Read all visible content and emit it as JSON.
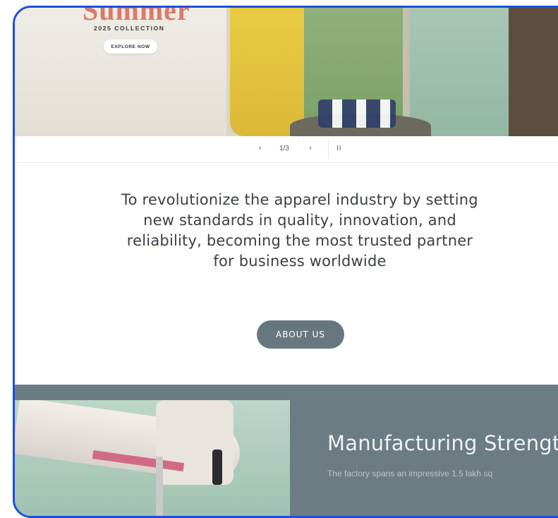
{
  "hero": {
    "title": "Summer",
    "subtitle": "2025 COLLECTION",
    "cta_label": "EXPLORE NOW"
  },
  "slider": {
    "prev_glyph": "‹",
    "counter": "1/3",
    "next_glyph": "›",
    "pause_glyph": "II"
  },
  "mission": {
    "text": "To revolutionize the apparel industry by setting new standards in quality, innovation, and reliability, becoming the most trusted partner for business worldwide",
    "button_label": "ABOUT US"
  },
  "manufacturing": {
    "title": "Manufacturing Strength",
    "text": "The factory spans an impressive 1.5 lakh sq"
  },
  "colors": {
    "frame_border": "#1a4fe0",
    "button_bg": "#66777e",
    "section_bg": "#6c7c83",
    "hero_title": "#d97a6a"
  }
}
